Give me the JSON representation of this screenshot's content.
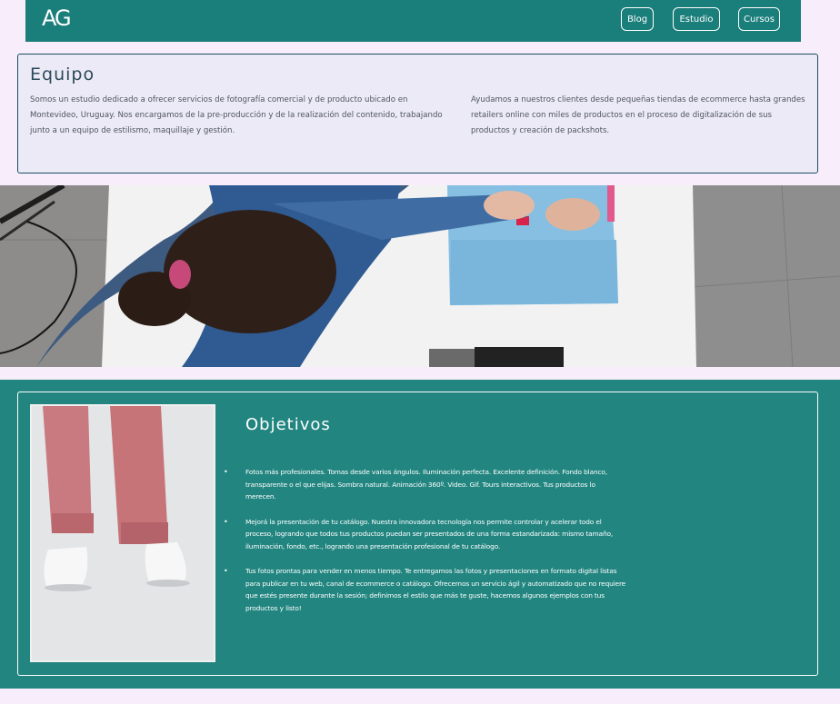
{
  "nav": {
    "logo": "AG",
    "links": [
      "Blog",
      "Estudio",
      "Cursos"
    ]
  },
  "equipo": {
    "title": "Equipo",
    "col1": "Somos un estudio dedicado a ofrecer servicios de fotografía comercial y de producto ubicado en Montevideo, Uruguay. Nos encargamos de la pre-producción y de la realización del contenido, trabajando junto a un equipo de estilismo, maquillaje y gestión.",
    "col2": "Ayudamos a nuestros clientes desde pequeñas tiendas de ecommerce hasta grandes retailers online con miles de productos en el proceso de digitalización de sus productos y creación de packshots."
  },
  "objetivos": {
    "title": "Objetivos",
    "items": [
      "Fotos más profesionales. Tomas desde varios ángulos. Iluminación perfecta. Excelente definición. Fondo blanco, transparente o el que elijas. Sombra natural. Animación 360º. Video. Gif. Tours interactivos. Tus productos lo merecen.",
      "Mejorá la presentación de tu catálogo. Nuestra innovadora tecnología nos permite controlar y acelerar todo el proceso, logrando que todos tus productos puedan ser presentados de una forma estandarizada: mismo tamaño, iluminación, fondo, etc., logrando una presentación profesional de tu catálogo.",
      "Tus fotos prontas para vender en menos tiempo. Te entregamos las fotos y presentaciones en formato digital listas para publicar en tu web, canal de ecommerce o catálogo. Ofrecemos un servicio ágil y automatizado que no requiere que estés presente durante la sesión; definimos el estilo que más te guste, hacemos algunos ejemplos con tus productos y listo!"
    ]
  },
  "colors": {
    "nav": "#1a7e7b",
    "section": "#228580",
    "page": "#f8eefb"
  }
}
